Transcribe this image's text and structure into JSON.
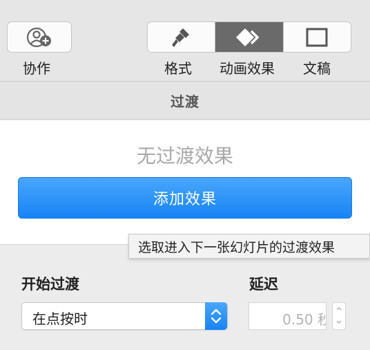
{
  "toolbar": {
    "collaborate_label": "协作",
    "format_label": "格式",
    "animate_label": "动画效果",
    "document_label": "文稿",
    "active_tab": "动画效果"
  },
  "section": {
    "title": "过渡"
  },
  "transition": {
    "empty_text": "无过渡效果",
    "add_button_label": "添加效果",
    "tooltip": "选取进入下一张幻灯片的过渡效果"
  },
  "controls": {
    "start_label": "开始过渡",
    "start_value": "在点按时",
    "delay_label": "延迟",
    "delay_value": "0.50 秒"
  },
  "colors": {
    "accent": "#1784f5",
    "active_segment": "#6a6a6a"
  },
  "icons": {
    "collaborate": "person-plus-icon",
    "format": "paintbrush-icon",
    "animate": "diamond-arrow-icon",
    "document": "document-square-icon",
    "select": "chevron-up-down-icon",
    "stepper": "stepper-arrows-icon"
  }
}
